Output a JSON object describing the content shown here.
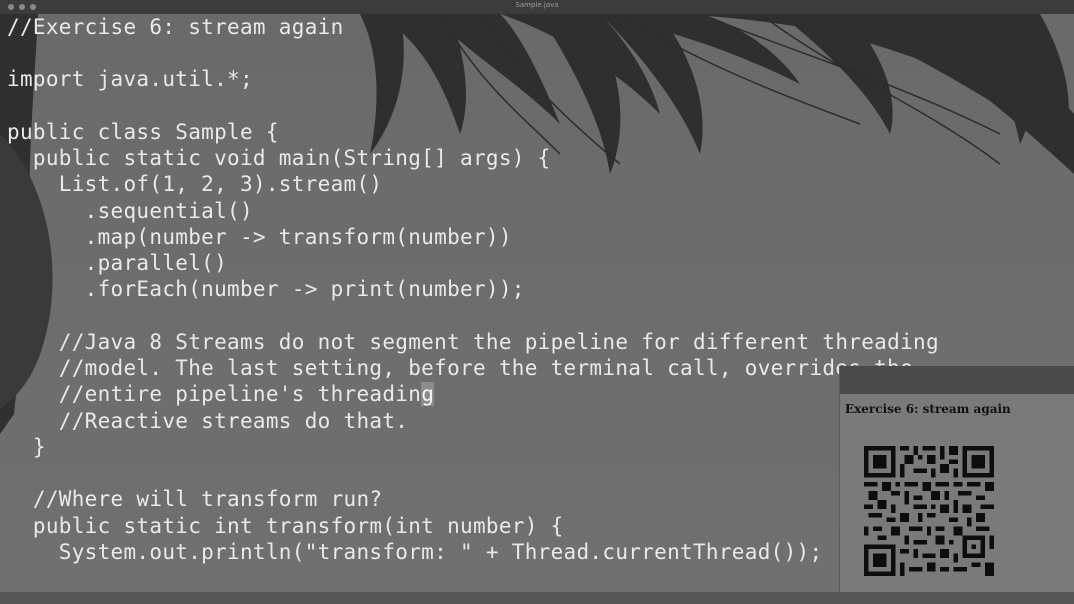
{
  "window": {
    "title": "Sample.java"
  },
  "editor": {
    "lines": [
      "//Exercise 6: stream again",
      "",
      "import java.util.*;",
      "",
      "public class Sample {",
      "  public static void main(String[] args) {",
      "    List.of(1, 2, 3).stream()",
      "      .sequential()",
      "      .map(number -> transform(number))",
      "      .parallel()",
      "      .forEach(number -> print(number));",
      "",
      "    //Java 8 Streams do not segment the pipeline for different threading",
      "    //model. The last setting, before the terminal call, overrides the",
      "    //entire pipeline's threading",
      "    //Reactive streams do that.",
      "  }",
      "",
      "  //Where will transform run?",
      "  public static int transform(int number) {",
      "    System.out.println(\"transform: \" + Thread.currentThread());"
    ],
    "cursor_line_prefix": "    //entire pipeline's threadin",
    "cursor_char": "g"
  },
  "panel": {
    "title": "Exercise 6: stream again"
  },
  "colors": {
    "code_text": "#e9e9e9",
    "background": "#6e6e6e"
  }
}
